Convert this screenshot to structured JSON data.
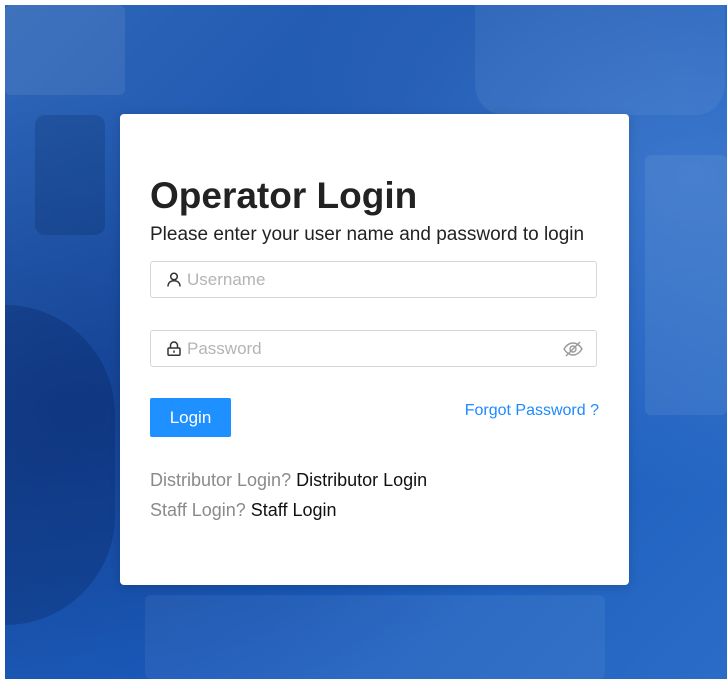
{
  "login": {
    "title": "Operator Login",
    "subtitle": "Please enter your user name and password to login",
    "username": {
      "placeholder": "Username",
      "value": "",
      "icon": "user-icon"
    },
    "password": {
      "placeholder": "Password",
      "value": "",
      "icon": "lock-icon",
      "toggle_icon": "eye-slash-icon"
    },
    "login_button": "Login",
    "forgot_password": "Forgot Password ?",
    "distributor": {
      "question": "Distributor Login?",
      "link": "Distributor Login"
    },
    "staff": {
      "question": "Staff Login?",
      "link": "Staff Login"
    }
  },
  "colors": {
    "primary": "#1e90ff",
    "link": "#1e8aff",
    "background": "#1d57b0"
  }
}
